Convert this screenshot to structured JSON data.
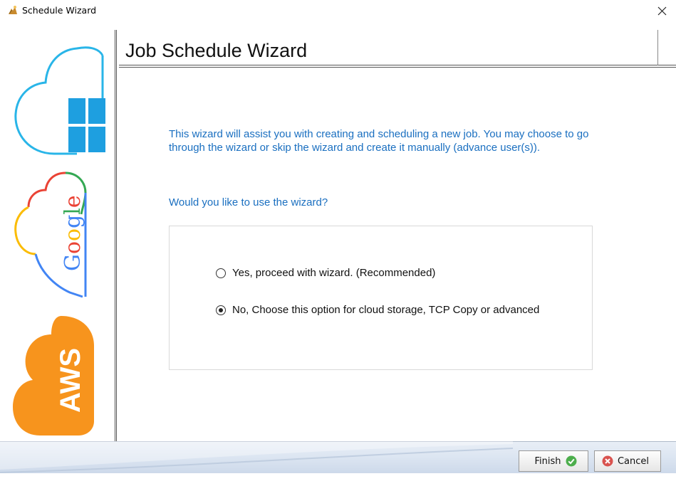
{
  "window": {
    "title": "Schedule Wizard",
    "close_icon": "close-icon"
  },
  "banner": {
    "windows_icon": "windows-cloud-icon",
    "google_label": "Google",
    "aws_label": "AWS"
  },
  "header": {
    "title": "Job Schedule Wizard"
  },
  "main": {
    "intro": "This wizard will assist you with creating and scheduling a new job. You may choose to go through the wizard or skip the wizard and create it manually (advance user(s)).",
    "question": "Would you like to use the wizard?",
    "options": [
      {
        "label": "Yes, proceed with wizard. (Recommended)",
        "checked": false
      },
      {
        "label": "No, Choose this option for cloud storage, TCP Copy or advanced",
        "checked": true
      }
    ]
  },
  "footer": {
    "finish_label": "Finish",
    "cancel_label": "Cancel"
  },
  "colors": {
    "accent_text": "#1a6fc0",
    "finish_icon": "#4cae4c",
    "cancel_icon": "#d9534f",
    "aws_orange": "#f7941d",
    "windows_blue": "#1e9fe0"
  }
}
